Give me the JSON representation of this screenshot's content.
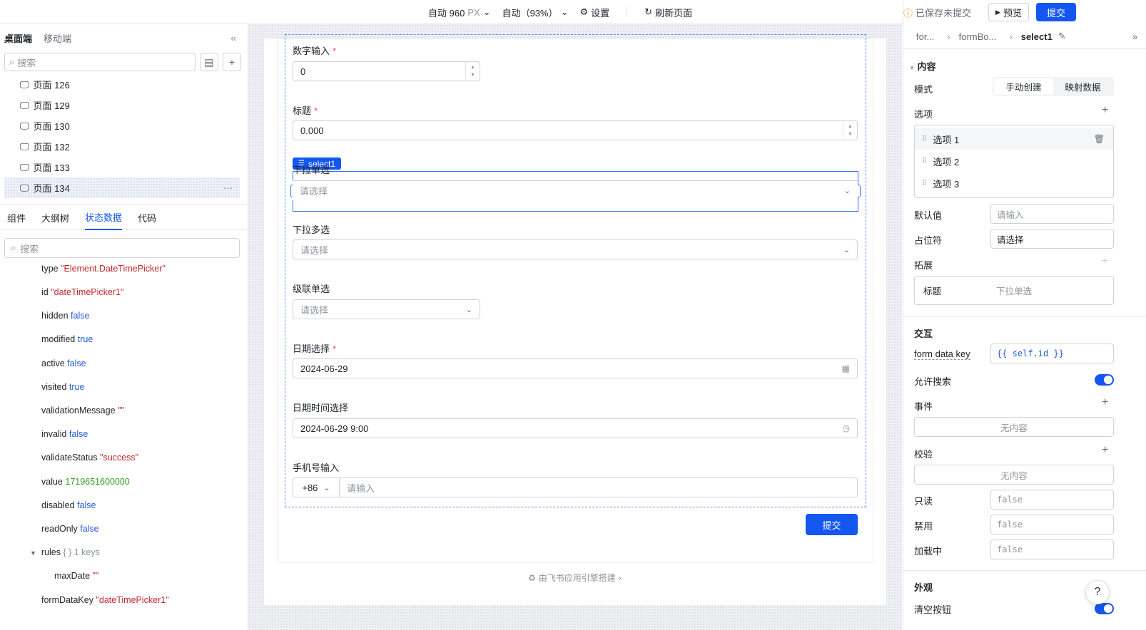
{
  "topbar": {
    "width_label": "自动 960",
    "width_unit": "PX",
    "zoom_label": "自动（93%）",
    "settings_label": "设置",
    "refresh_label": "刷新页面",
    "unsaved_label": "已保存未提交",
    "preview_label": "预览",
    "submit_label": "提交"
  },
  "left": {
    "tab_desktop": "桌面端",
    "tab_mobile": "移动端",
    "search_placeholder": "搜索",
    "pages": [
      "页面 126",
      "页面 129",
      "页面 130",
      "页面 132",
      "页面 133",
      "页面 134"
    ],
    "panel_tabs": [
      "组件",
      "大纲树",
      "状态数据",
      "代码"
    ],
    "search2_placeholder": "搜索",
    "state": [
      {
        "k": "type",
        "v": "\"Element.DateTimePicker\"",
        "t": "s"
      },
      {
        "k": "id",
        "v": "\"dateTimePicker1\"",
        "t": "s"
      },
      {
        "k": "hidden",
        "v": "false",
        "t": "b"
      },
      {
        "k": "modified",
        "v": "true",
        "t": "b"
      },
      {
        "k": "active",
        "v": "false",
        "t": "b"
      },
      {
        "k": "visited",
        "v": "true",
        "t": "b"
      },
      {
        "k": "validationMessage",
        "v": "\"\"",
        "t": "s"
      },
      {
        "k": "invalid",
        "v": "false",
        "t": "b"
      },
      {
        "k": "validateStatus",
        "v": "\"success\"",
        "t": "s"
      },
      {
        "k": "value",
        "v": "1719651600000",
        "t": "n"
      },
      {
        "k": "disabled",
        "v": "false",
        "t": "b"
      },
      {
        "k": "readOnly",
        "v": "false",
        "t": "b"
      },
      {
        "k": "rules",
        "v": "{ } 1 keys",
        "t": "g"
      },
      {
        "k": "maxDate",
        "v": "\"\"",
        "t": "s"
      },
      {
        "k": "formDataKey",
        "v": "\"dateTimePicker1\"",
        "t": "s"
      }
    ]
  },
  "form": {
    "f1_label": "数字输入",
    "f1_value": "0",
    "f2_label": "标题",
    "f2_value": "0.000",
    "tag_label": "select1",
    "f3_label": "下拉单选",
    "f3_placeholder": "请选择",
    "f4_label": "下拉多选",
    "f4_placeholder": "请选择",
    "f5_label": "级联单选",
    "f5_placeholder": "请选择",
    "f6_label": "日期选择",
    "f6_value": "2024-06-29",
    "f7_label": "日期时间选择",
    "f7_value": "2024-06-29 9:00",
    "f8_label": "手机号输入",
    "f8_code": "+86",
    "f8_placeholder": "请输入",
    "submit": "提交",
    "powered_by": "由飞书应用引擎搭建"
  },
  "right": {
    "crumb1": "for...",
    "crumb2": "formBo...",
    "crumb3": "select1",
    "sec_content": "内容",
    "mode_label": "模式",
    "mode_manual": "手动创建",
    "mode_map": "映射数据",
    "options_label": "选项",
    "options": [
      "选项 1",
      "选项 2",
      "选项 3"
    ],
    "default_label": "默认值",
    "default_placeholder": "请输入",
    "placeholder_label": "占位符",
    "placeholder_value": "请选择",
    "extend_label": "拓展",
    "extend_key": "标题",
    "extend_value": "下拉单选",
    "sec_interact": "交互",
    "formkey_label": "form data key",
    "formkey_value": "{{ self.id }}",
    "allow_search": "允许搜索",
    "events": "事件",
    "no_content": "无内容",
    "validate": "校验",
    "no_content2": "无内容",
    "readonly": "只读",
    "readonly_value": "false",
    "disabled": "禁用",
    "disabled_value": "false",
    "loading": "加载中",
    "loading_value": "false",
    "sec_look": "外观",
    "clear_btn": "清空按钮"
  }
}
